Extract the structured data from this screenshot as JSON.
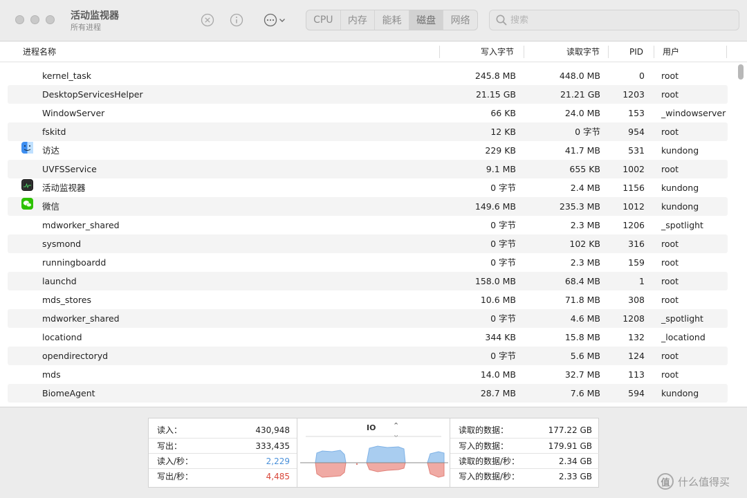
{
  "window": {
    "title": "活动监视器",
    "subtitle": "所有进程"
  },
  "tabs": [
    {
      "label": "CPU",
      "active": false
    },
    {
      "label": "内存",
      "active": false
    },
    {
      "label": "能耗",
      "active": false
    },
    {
      "label": "磁盘",
      "active": true
    },
    {
      "label": "网络",
      "active": false
    }
  ],
  "search": {
    "placeholder": "搜索"
  },
  "columns": {
    "name": "进程名称",
    "write": "写入字节",
    "read": "读取字节",
    "pid": "PID",
    "user": "用户"
  },
  "processes": [
    {
      "name": "kernel_task",
      "write": "245.8 MB",
      "read": "448.0 MB",
      "pid": "0",
      "user": "root",
      "icon": ""
    },
    {
      "name": "DesktopServicesHelper",
      "write": "21.15 GB",
      "read": "21.21 GB",
      "pid": "1203",
      "user": "root",
      "icon": ""
    },
    {
      "name": "WindowServer",
      "write": "66 KB",
      "read": "24.0 MB",
      "pid": "153",
      "user": "_windowserver",
      "icon": ""
    },
    {
      "name": "fskitd",
      "write": "12 KB",
      "read": "0 字节",
      "pid": "954",
      "user": "root",
      "icon": ""
    },
    {
      "name": "访达",
      "write": "229 KB",
      "read": "41.7 MB",
      "pid": "531",
      "user": "kundong",
      "icon": "finder-icon"
    },
    {
      "name": "UVFSService",
      "write": "9.1 MB",
      "read": "655 KB",
      "pid": "1002",
      "user": "root",
      "icon": ""
    },
    {
      "name": "活动监视器",
      "write": "0 字节",
      "read": "2.4 MB",
      "pid": "1156",
      "user": "kundong",
      "icon": "activity-monitor-icon"
    },
    {
      "name": "微信",
      "write": "149.6 MB",
      "read": "235.3 MB",
      "pid": "1012",
      "user": "kundong",
      "icon": "wechat-icon"
    },
    {
      "name": "mdworker_shared",
      "write": "0 字节",
      "read": "2.3 MB",
      "pid": "1206",
      "user": "_spotlight",
      "icon": ""
    },
    {
      "name": "sysmond",
      "write": "0 字节",
      "read": "102 KB",
      "pid": "316",
      "user": "root",
      "icon": ""
    },
    {
      "name": "runningboardd",
      "write": "0 字节",
      "read": "2.3 MB",
      "pid": "159",
      "user": "root",
      "icon": ""
    },
    {
      "name": "launchd",
      "write": "158.0 MB",
      "read": "68.4 MB",
      "pid": "1",
      "user": "root",
      "icon": ""
    },
    {
      "name": "mds_stores",
      "write": "10.6 MB",
      "read": "71.8 MB",
      "pid": "308",
      "user": "root",
      "icon": ""
    },
    {
      "name": "mdworker_shared",
      "write": "0 字节",
      "read": "4.6 MB",
      "pid": "1208",
      "user": "_spotlight",
      "icon": ""
    },
    {
      "name": "locationd",
      "write": "344 KB",
      "read": "15.8 MB",
      "pid": "132",
      "user": "_locationd",
      "icon": ""
    },
    {
      "name": "opendirectoryd",
      "write": "0 字节",
      "read": "5.6 MB",
      "pid": "124",
      "user": "root",
      "icon": ""
    },
    {
      "name": "mds",
      "write": "14.0 MB",
      "read": "32.7 MB",
      "pid": "113",
      "user": "root",
      "icon": ""
    },
    {
      "name": "BiomeAgent",
      "write": "28.7 MB",
      "read": "7.6 MB",
      "pid": "594",
      "user": "kundong",
      "icon": ""
    }
  ],
  "stats_left": [
    {
      "label": "读入：",
      "value": "430,948",
      "color": "#222222"
    },
    {
      "label": "写出：",
      "value": "333,435",
      "color": "#222222"
    },
    {
      "label": "读入/秒：",
      "value": "2,229",
      "color": "#4a90d9"
    },
    {
      "label": "写出/秒：",
      "value": "4,485",
      "color": "#d9473a"
    }
  ],
  "graph": {
    "title": "IO",
    "read_color": "#a9cdf0",
    "write_color": "#f0aaa4"
  },
  "stats_right": [
    {
      "label": "读取的数据：",
      "value": "177.22 GB"
    },
    {
      "label": "写入的数据：",
      "value": "179.91 GB"
    },
    {
      "label": "读取的数据/秒：",
      "value": "2.34 GB"
    },
    {
      "label": "写入的数据/秒：",
      "value": "2.33 GB"
    }
  ],
  "watermark": {
    "logo": "值",
    "text": "什么值得买"
  }
}
